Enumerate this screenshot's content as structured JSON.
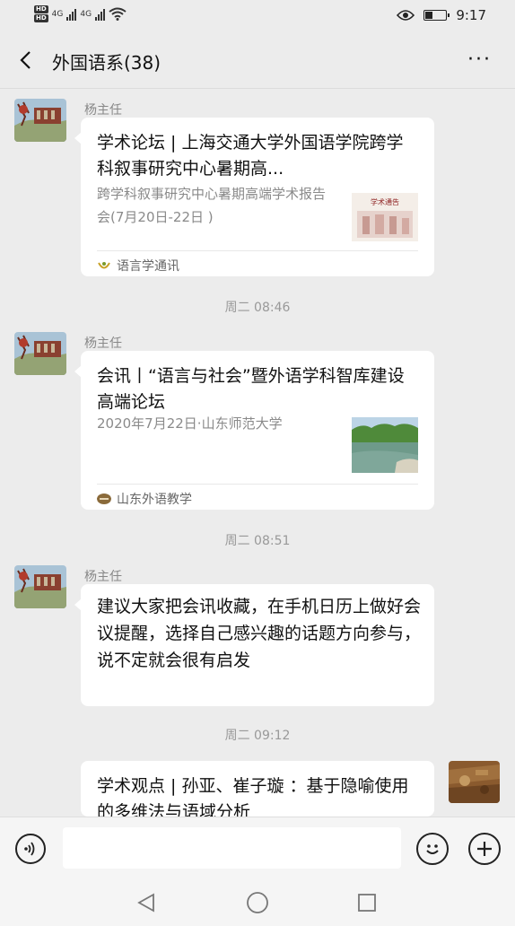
{
  "status_bar": {
    "hd1": "HD",
    "hd2": "HD",
    "net1": "4G",
    "net2": "4G",
    "time": "9:17"
  },
  "header": {
    "title": "外国语系(38)",
    "more": "···"
  },
  "messages": [
    {
      "sender": "杨主任",
      "card_title": "学术论坛 | 上海交通大学外国语学院跨学科叙事研究中心暑期高...",
      "card_desc": "跨学科叙事研究中心暑期高端学术报告会(7月20日-22日 )",
      "source": "语言学通讯",
      "thumb_text": "学术通告"
    },
    {
      "time": "周二 08:46"
    },
    {
      "sender": "杨主任",
      "card_title": "会讯丨“语言与社会”暨外语学科智库建设高端论坛",
      "card_desc": "2020年7月22日·山东师范大学",
      "source": "山东外语教学"
    },
    {
      "time": "周二 08:51"
    },
    {
      "sender": "杨主任",
      "text": "建议大家把会讯收藏，在手机日历上做好会议提醒，选择自己感兴趣的话题方向参与，说不定就会很有启发"
    },
    {
      "time": "周二 09:12"
    },
    {
      "card_title": "学术观点 | 孙亚、崔子璇 ：基于隐喻使用的多维法与语域分析"
    }
  ],
  "input": {
    "value": "",
    "placeholder": ""
  },
  "colors": {
    "background": "#ececec",
    "bubble": "#ffffff",
    "muted": "#888888"
  },
  "icons": [
    "back-icon",
    "more-icon",
    "voice-icon",
    "emoji-icon",
    "plus-icon",
    "nav-back-icon",
    "nav-home-icon",
    "nav-recents-icon"
  ]
}
